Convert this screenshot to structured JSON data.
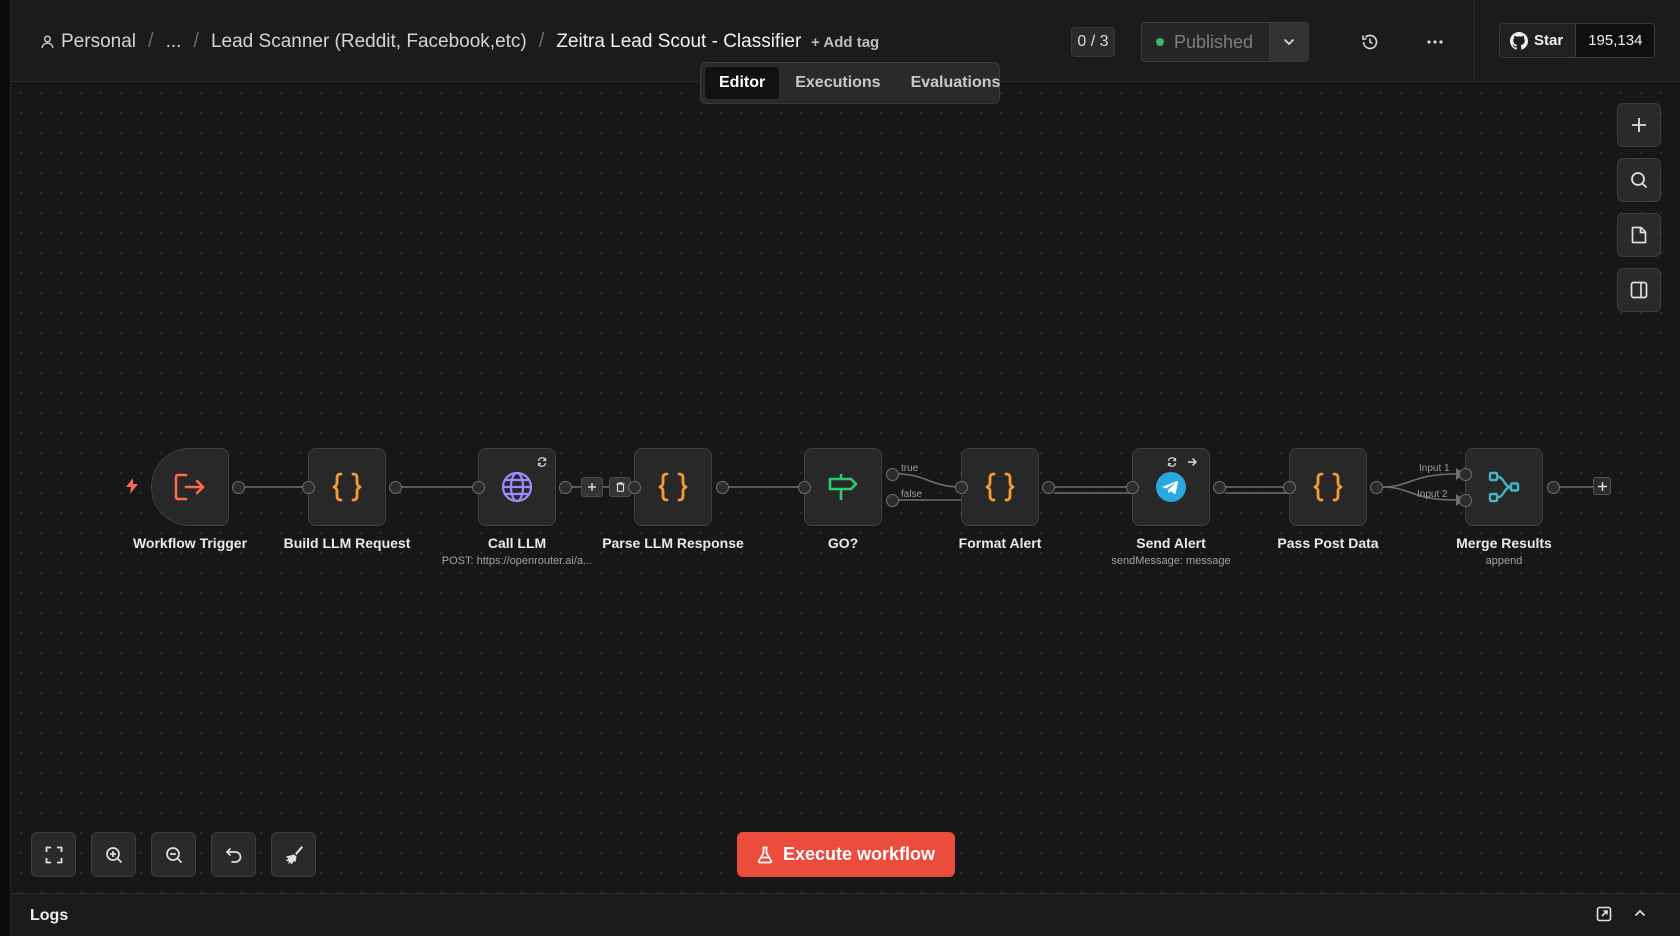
{
  "breadcrumb": {
    "owner": "Personal",
    "ellipsis": "...",
    "folder": "Lead Scanner (Reddit, Facebook,etc)",
    "workflow": "Zeitra Lead Scout - Classifier"
  },
  "header": {
    "add_tag": "+ Add tag",
    "counter": "0 / 3",
    "published_label": "Published",
    "github_star": "Star",
    "github_count": "195,134"
  },
  "tabs": [
    {
      "label": "Editor",
      "active": true
    },
    {
      "label": "Executions",
      "active": false
    },
    {
      "label": "Evaluations",
      "active": false
    }
  ],
  "nodes": [
    {
      "id": "trigger",
      "label": "Workflow Trigger",
      "icon": "sign-in-icon"
    },
    {
      "id": "build",
      "label": "Build LLM Request",
      "icon": "code-braces-icon"
    },
    {
      "id": "call",
      "label": "Call LLM",
      "subtitle": "POST: https://openrouter.ai/a...",
      "icon": "globe-icon"
    },
    {
      "id": "parse",
      "label": "Parse LLM Response",
      "icon": "code-braces-icon"
    },
    {
      "id": "go",
      "label": "GO?",
      "icon": "signpost-icon"
    },
    {
      "id": "format",
      "label": "Format Alert",
      "icon": "code-braces-icon"
    },
    {
      "id": "send",
      "label": "Send Alert",
      "subtitle": "sendMessage: message",
      "icon": "telegram-icon"
    },
    {
      "id": "pass",
      "label": "Pass Post Data",
      "icon": "code-braces-icon"
    },
    {
      "id": "merge",
      "label": "Merge Results",
      "subtitle": "append",
      "icon": "merge-icon"
    }
  ],
  "edge_labels": {
    "true": "true",
    "false": "false",
    "input1": "Input 1",
    "input2": "Input 2"
  },
  "execute_label": "Execute workflow",
  "logs_label": "Logs",
  "colors": {
    "accent": "#ec4c3c",
    "code_orange": "#f39c34",
    "globe_purple": "#9b8cff",
    "signpost_green": "#2ecc71",
    "telegram_blue": "#2aa6e0",
    "merge_teal": "#40b8c8",
    "trigger_red": "#ff6a4d",
    "published_dot": "#3fb56a"
  }
}
